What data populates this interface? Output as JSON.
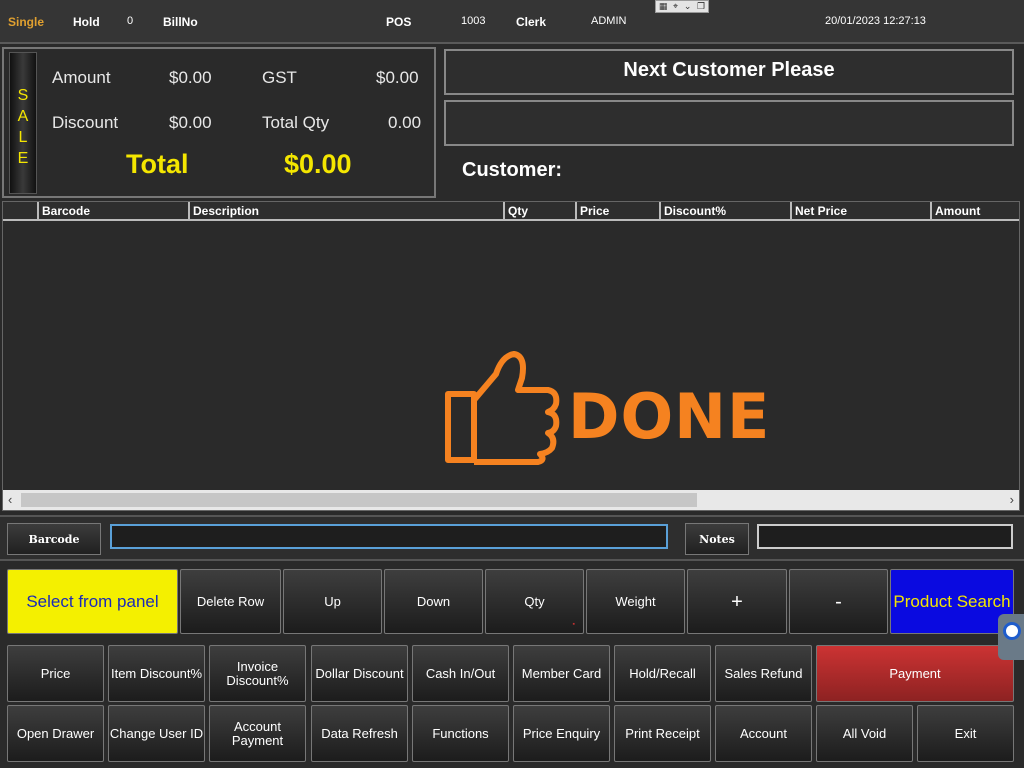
{
  "status": {
    "mode": "Single",
    "hold_label": "Hold",
    "hold_count": "0",
    "billno_label": "BillNo",
    "pos_label": "POS",
    "pos_number": "1003",
    "clerk_label": "Clerk",
    "clerk_name": "ADMIN",
    "datetime": "20/01/2023 12:27:13"
  },
  "sale_strip": [
    "S",
    "A",
    "L",
    "E"
  ],
  "summary": {
    "amount_label": "Amount",
    "amount": "$0.00",
    "gst_label": "GST",
    "gst": "$0.00",
    "discount_label": "Discount",
    "discount": "$0.00",
    "total_qty_label": "Total Qty",
    "total_qty": "0.00",
    "total_label": "Total",
    "total": "$0.00"
  },
  "display": {
    "message": "Next Customer Please",
    "customer_label": "Customer:"
  },
  "grid": {
    "columns": [
      "Barcode",
      "Description",
      "Qty",
      "Price",
      "Discount%",
      "Net Price",
      "Amount"
    ]
  },
  "overlay": {
    "text": "DONE"
  },
  "entry": {
    "barcode_label": "Barcode",
    "notes_label": "Notes",
    "barcode_value": "",
    "notes_value": ""
  },
  "row1": {
    "select_panel": "Select from panel",
    "delete_row": "Delete Row",
    "up": "Up",
    "down": "Down",
    "qty": "Qty",
    "weight": "Weight",
    "plus": "+",
    "minus": "-",
    "product_search": "Product Search"
  },
  "row2": {
    "price": "Price",
    "item_discount": "Item Discount%",
    "invoice_discount": "Invoice Discount%",
    "dollar_discount": "Dollar Discount",
    "cash_in_out": "Cash In/Out",
    "member_card": "Member Card",
    "hold_recall": "Hold/Recall",
    "sales_refund": "Sales Refund",
    "payment": "Payment"
  },
  "row3": {
    "open_drawer": "Open Drawer",
    "change_user": "Change User ID",
    "account_payment": "Account Payment",
    "data_refresh": "Data Refresh",
    "functions": "Functions",
    "price_enquiry": "Price Enquiry",
    "print_receipt": "Print Receipt",
    "account": "Account",
    "all_void": "All Void",
    "exit": "Exit"
  },
  "colors": {
    "accent_yellow": "#f4e600",
    "done_orange": "#f58220",
    "payment_red": "#c33",
    "search_blue": "#0a0ae0"
  }
}
